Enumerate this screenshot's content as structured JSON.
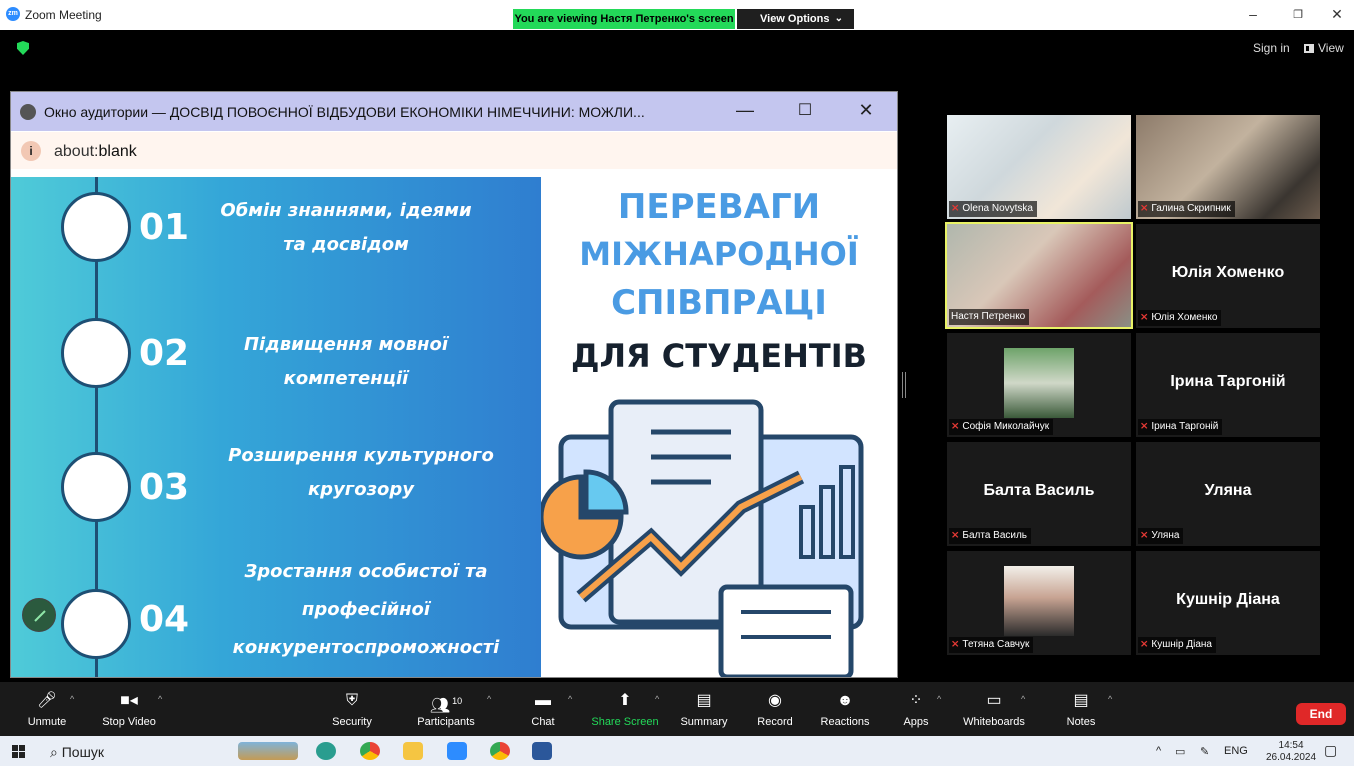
{
  "window": {
    "app_title": "Zoom Meeting",
    "viewing_banner": "You are viewing Настя Петренко's screen",
    "view_options": "View Options",
    "sign_in": "Sign in",
    "view": "View"
  },
  "shared_window": {
    "title": "Окно аудитории — ДОСВІД ПОВОЄННОЇ ВІДБУДОВИ ЕКОНОМІКИ НІМЕЧЧИНИ: МОЖЛИ...",
    "address_prefix": "about:",
    "address_main": "blank"
  },
  "slide": {
    "items": [
      {
        "num": "01",
        "line1": "Обмін знаннями, ідеями",
        "line2": "та досвідом",
        "line3": ""
      },
      {
        "num": "02",
        "line1": "Підвищення мовної",
        "line2": "компетенції",
        "line3": ""
      },
      {
        "num": "03",
        "line1": "Розширення культурного",
        "line2": "кругозору",
        "line3": ""
      },
      {
        "num": "04",
        "line1": "Зростання особистої та",
        "line2": "професійної",
        "line3": "конкурентоспроможності"
      }
    ],
    "heading": {
      "line1": "ПЕРЕВАГИ",
      "line2": "МІЖНАРОДНОЇ",
      "line3": "СПІВПРАЦІ",
      "line4": "ДЛЯ СТУДЕНТІВ"
    }
  },
  "participants": [
    {
      "name": "Olena Novytska",
      "video": true,
      "muted": true
    },
    {
      "name": "Галина Скрипник",
      "video": true,
      "muted": true
    },
    {
      "name": "Настя Петренко",
      "video": true,
      "muted": false,
      "active": true
    },
    {
      "name": "Юлія Хоменко",
      "video": false,
      "muted": true
    },
    {
      "name": "Софія Миколайчук",
      "video": true,
      "muted": true
    },
    {
      "name": "Ірина Таргоній",
      "video": false,
      "muted": true
    },
    {
      "name": "Балта Василь",
      "video": false,
      "muted": true
    },
    {
      "name": "Уляна",
      "video": false,
      "muted": true
    },
    {
      "name": "Тетяна Савчук",
      "video": true,
      "muted": true
    },
    {
      "name": "Кушнір Діана",
      "video": false,
      "muted": true
    }
  ],
  "toolbar": {
    "unmute": "Unmute",
    "stop_video": "Stop Video",
    "security": "Security",
    "participants": "Participants",
    "participants_count": "10",
    "chat": "Chat",
    "share_screen": "Share Screen",
    "summary": "Summary",
    "record": "Record",
    "reactions": "Reactions",
    "apps": "Apps",
    "whiteboards": "Whiteboards",
    "notes": "Notes",
    "end": "End"
  },
  "taskbar": {
    "search": "Пошук",
    "lang": "ENG",
    "time": "14:54",
    "date": "26.04.2024"
  },
  "colors": {
    "zoom_blue": "#2d8cff",
    "banner_green": "#23d959",
    "end_red": "#e02828",
    "active_border": "#e8f266",
    "slide_blue": "#4a9be3"
  }
}
